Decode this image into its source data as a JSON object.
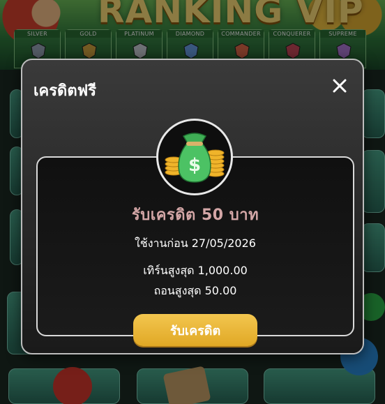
{
  "banner": {
    "title": "RANKING VIP",
    "tiers": [
      {
        "label": "SILVER",
        "color": "#9aa6b8"
      },
      {
        "label": "GOLD",
        "color": "#d4a640"
      },
      {
        "label": "PLATINUM",
        "color": "#c9ced6"
      },
      {
        "label": "DIAMOND",
        "color": "#6aa0e8"
      },
      {
        "label": "COMMANDER",
        "color": "#e06a4a"
      },
      {
        "label": "CONQUERER",
        "color": "#c94a5a"
      },
      {
        "label": "SUPREME",
        "color": "#b07ad8"
      }
    ]
  },
  "modal": {
    "title": "เครดิตฟรี",
    "close_icon": "close-icon",
    "reward_icon": "money-bag-icon",
    "headline": "รับเครดิต 50 บาท",
    "expiry": "ใช้งานก่อน 27/05/2026",
    "max_deposit": "เทิร์นสูงสุด 1,000.00",
    "max_withdraw": "ถอนสูงสุด 50.00",
    "claim_label": "รับเครดิต"
  },
  "colors": {
    "accent_gold": "#f3c64f",
    "headline": "#d4a7a7"
  }
}
